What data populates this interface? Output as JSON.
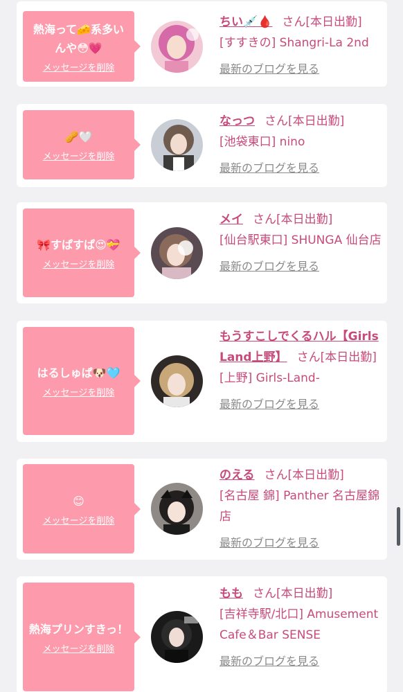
{
  "delete_label": "メッセージを削除",
  "blog_label": "最新のブログを見る",
  "san_label": "さん",
  "status_label": "[本日出勤]",
  "colors": {
    "bubble": "#fd9aac",
    "name": "#c84a7a",
    "link_gray": "#8a8a8a",
    "page_bg": "#f1f1f3"
  },
  "cards": [
    {
      "message": "熱海って🧀系多いんや😳💗",
      "name": "ちい💉🩸",
      "location": "[すすきの] Shangri-La 2nd",
      "avatar_icon": "pink-cosplay-girl-avatar"
    },
    {
      "message": "🥜🤍",
      "name": "なっつ",
      "location": "[池袋東口] nino",
      "avatar_icon": "maid-girl-avatar"
    },
    {
      "message": "🎀すぱすぱ😍💝",
      "name": "メイ",
      "location": "[仙台駅東口] SHUNGA 仙台店",
      "avatar_icon": "peace-sign-girl-avatar"
    },
    {
      "message": "はるしゅぱ🐶🩵",
      "name": "もうすこしでくるハル【Girls Land上野】",
      "location": "[上野] Girls-Land-",
      "avatar_icon": "blonde-girl-avatar"
    },
    {
      "message": "😊",
      "name": "のえる",
      "location": "[名古屋 錦] Panther 名古屋錦店",
      "avatar_icon": "headband-girl-avatar"
    },
    {
      "message": "熱海プリンすきっ！",
      "name": "もも",
      "location": "[吉祥寺駅/北口] Amusement Cafe＆Bar SENSE",
      "avatar_icon": "dark-outfit-girl-avatar"
    }
  ]
}
